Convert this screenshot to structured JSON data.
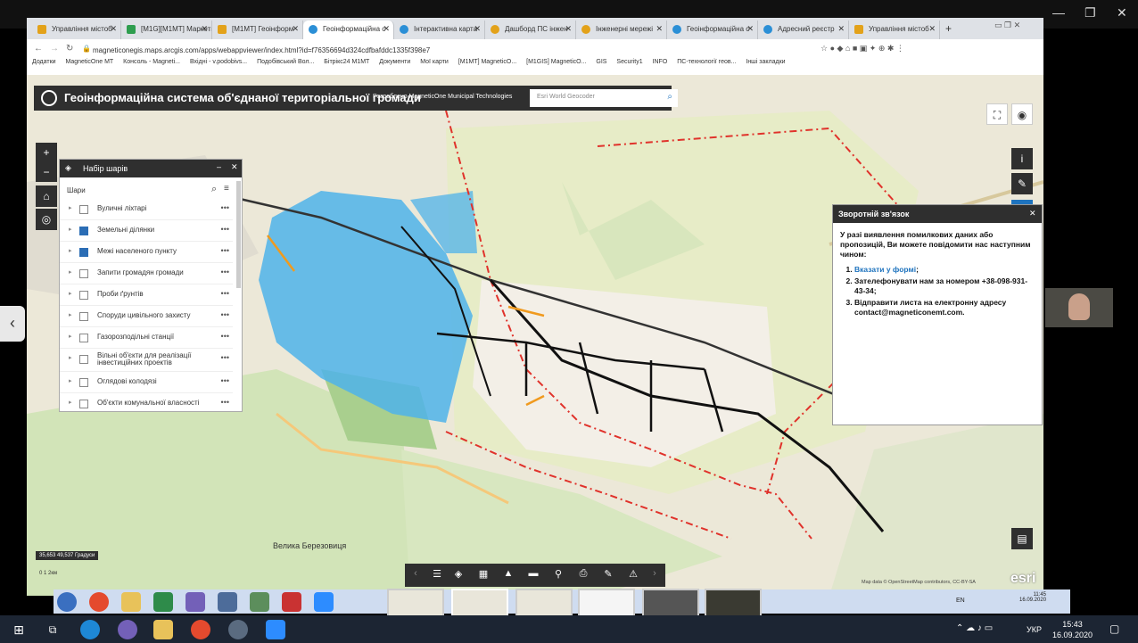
{
  "browser": {
    "tabs": [
      {
        "label": "Управління містоб"
      },
      {
        "label": "[M1G][M1MT] Маркетинг"
      },
      {
        "label": "[M1MT] Геоінформ"
      },
      {
        "label": "Геоінформаційна с"
      },
      {
        "label": "Інтерактивна карта"
      },
      {
        "label": "Дашборд ПС інжен"
      },
      {
        "label": "Інженерні мережі"
      },
      {
        "label": "Геоінформаційна с"
      },
      {
        "label": "Адресний реєстр"
      },
      {
        "label": "Управління містоб"
      }
    ],
    "url": "magneticonegis.maps.arcgis.com/apps/webappviewer/index.html?id=f76356694d324cdfbafddc1335f398e7",
    "bookmarks": [
      "Додатки",
      "MagneticOne MT",
      "Консоль - Magneti...",
      "Вхідні - v.podobivs...",
      "Подобівський Вол...",
      "Бітрікс24 M1MT",
      "Документи",
      "Мої карти",
      "[M1MT] MagneticO...",
      "[M1GIS] MagneticO...",
      "GIS",
      "Security1",
      "INFO",
      "ПС-технології геов...",
      "Інші закладки"
    ]
  },
  "app": {
    "title": "Геоінформаційна система об'єднаної територіальної громади",
    "subtitle": "Розроблено MagneticOne Municipal Technologies",
    "search_placeholder": "Esri World Geocoder"
  },
  "layers_panel": {
    "title": "Набір шарів",
    "section": "Шари",
    "items": [
      {
        "label": "Вуличні ліхтарі",
        "checked": false
      },
      {
        "label": "Земельні ділянки",
        "checked": true
      },
      {
        "label": "Межі населеного пункту",
        "checked": true
      },
      {
        "label": "Запити громадян громади",
        "checked": false
      },
      {
        "label": "Проби ґрунтів",
        "checked": false
      },
      {
        "label": "Споруди цивільного захисту",
        "checked": false
      },
      {
        "label": "Газорозподільні станції",
        "checked": false
      },
      {
        "label": "Вільні об'єкти для реалізації інвестиційних проектів",
        "checked": false
      },
      {
        "label": "Оглядові колодязі",
        "checked": false
      },
      {
        "label": "Об'єкти комунальної власності",
        "checked": false
      }
    ]
  },
  "feedback": {
    "title": "Зворотній зв'язок",
    "intro": "У разі виявлення помилкових даних або пропозицій, Ви можете повідомити нас наступним чином:",
    "item1": "Вказати у формі",
    "item2": "Зателефонувати нам за номером +38-098-931-43-34;",
    "item3": "Відправити листа на електронну адресу contact@magneticonemt.com."
  },
  "map": {
    "coords": "35,653 49,537 Градуси",
    "village": "Велика Березовиця",
    "attribution": "Map data © OpenStreetMap contributors, CC-BY-SA",
    "esri": "esri",
    "scale": "0       1       2км"
  },
  "remote_taskbar": {
    "lang": "EN",
    "time": "11:45",
    "date": "16.09.2020"
  },
  "os_taskbar": {
    "lang": "УКР",
    "time": "15:43",
    "date": "16.09.2020"
  },
  "colors": {
    "dark": "#2f2f2f",
    "parcel": "#4fb3ea",
    "boundary": "#e0322b",
    "accent": "#1e73be"
  }
}
